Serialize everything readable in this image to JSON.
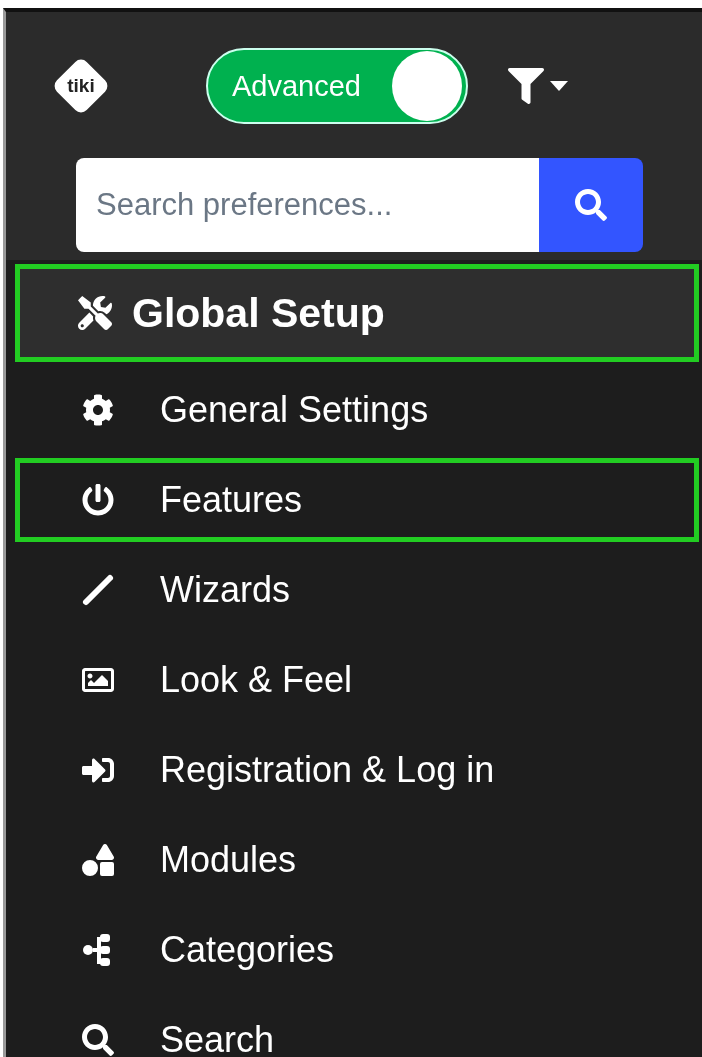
{
  "header": {
    "logo": "tiki",
    "mode_toggle": {
      "label": "Advanced",
      "on": true
    }
  },
  "search": {
    "placeholder": "Search preferences..."
  },
  "section": {
    "title": "Global Setup",
    "highlighted": true
  },
  "items": [
    {
      "label": "General Settings",
      "highlighted": false
    },
    {
      "label": "Features",
      "highlighted": true
    },
    {
      "label": "Wizards",
      "highlighted": false
    },
    {
      "label": "Look & Feel",
      "highlighted": false
    },
    {
      "label": "Registration & Log in",
      "highlighted": false
    },
    {
      "label": "Modules",
      "highlighted": false
    },
    {
      "label": "Categories",
      "highlighted": false
    },
    {
      "label": "Search",
      "highlighted": false
    }
  ]
}
